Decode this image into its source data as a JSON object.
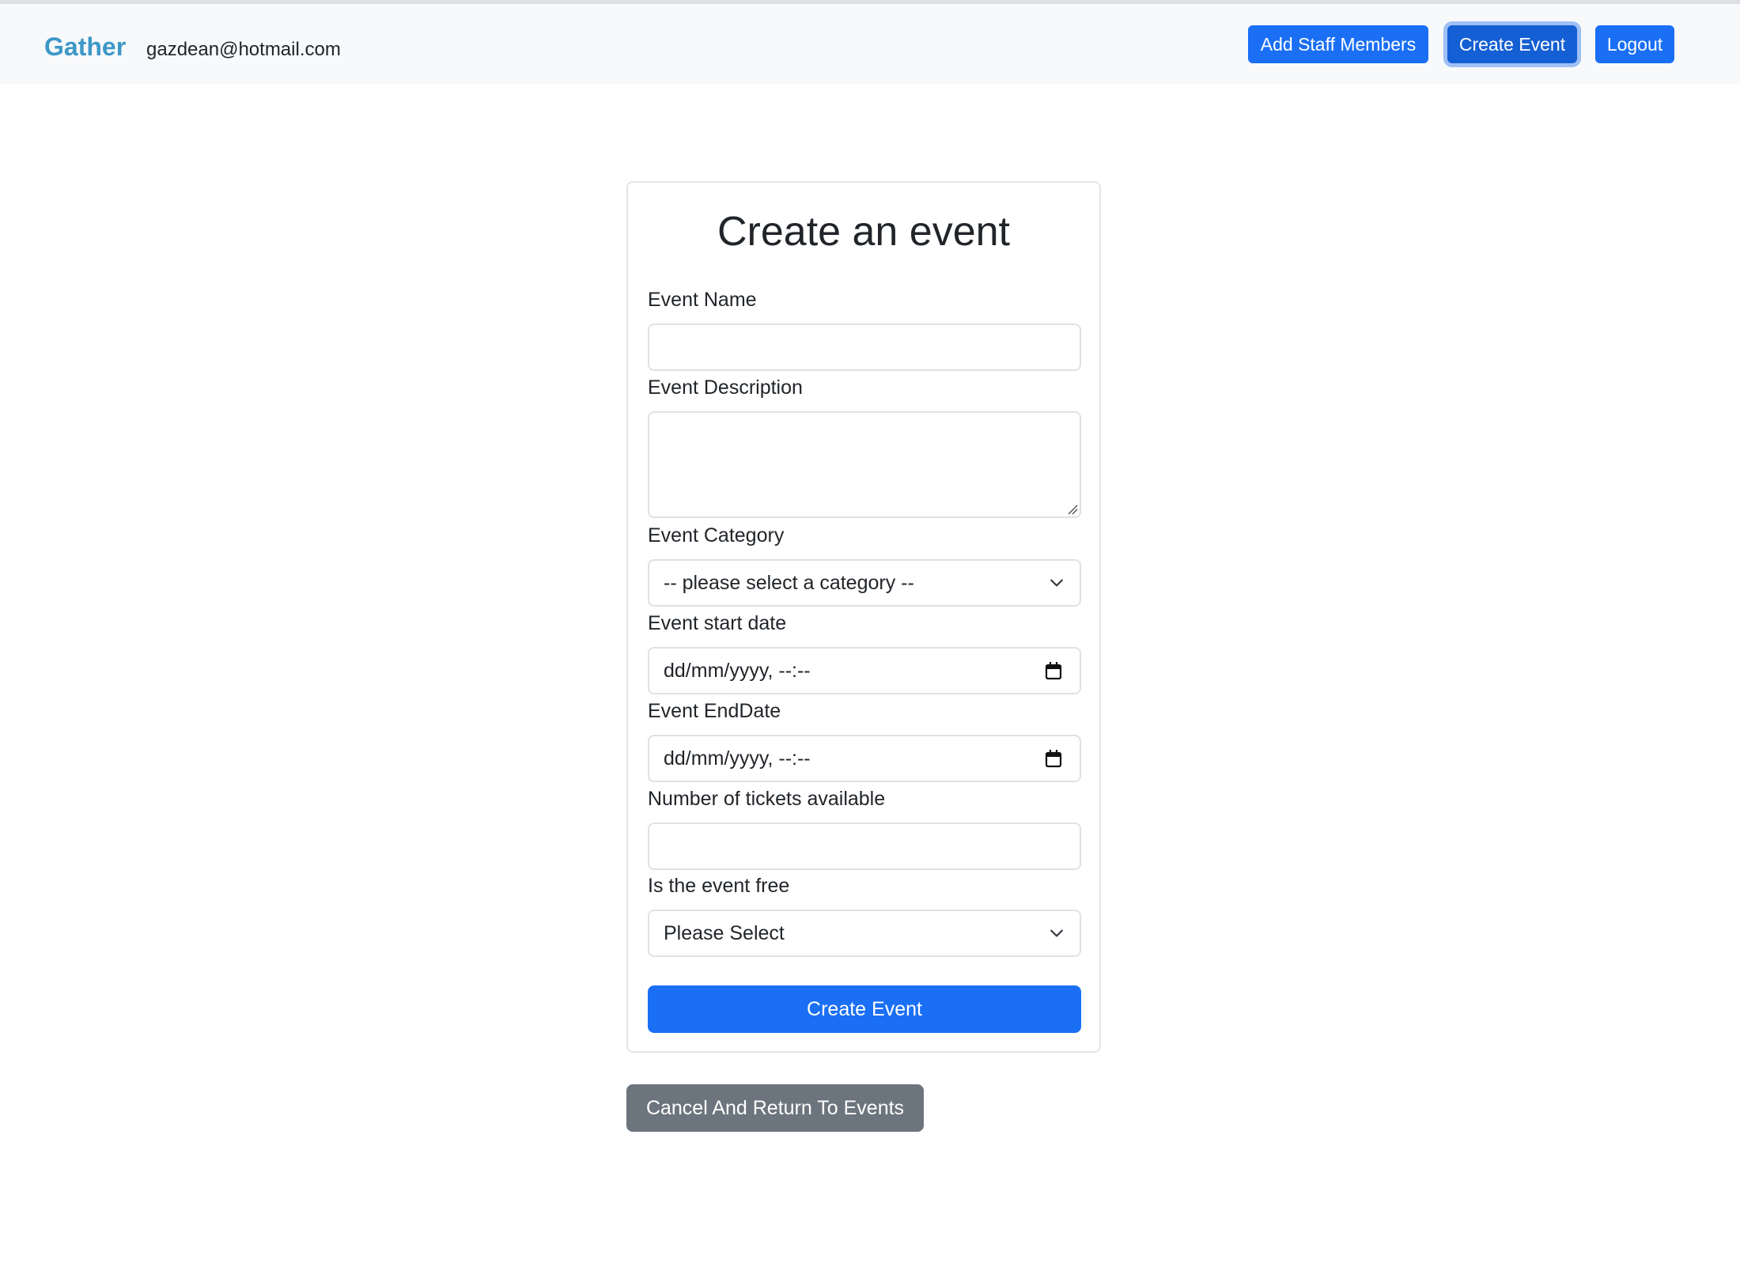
{
  "navbar": {
    "brand": "Gather",
    "user_email": "gazdean@hotmail.com",
    "buttons": {
      "add_staff": "Add Staff Members",
      "create_event": "Create Event",
      "logout": "Logout"
    }
  },
  "form": {
    "title": "Create an event",
    "event_name": {
      "label": "Event Name",
      "value": ""
    },
    "event_description": {
      "label": "Event Description",
      "value": ""
    },
    "event_category": {
      "label": "Event Category",
      "selected": "-- please select a category --"
    },
    "start_date": {
      "label": "Event start date",
      "value": "dd/mm/yyyy, --:--"
    },
    "end_date": {
      "label": "Event EndDate",
      "value": "dd/mm/yyyy, --:--"
    },
    "tickets": {
      "label": "Number of tickets available",
      "value": ""
    },
    "is_free": {
      "label": "Is the event free",
      "selected": "Please Select"
    },
    "submit_label": "Create Event"
  },
  "cancel_label": "Cancel And Return To Events",
  "icons": {
    "chevron": "chevron-down-icon",
    "calendar": "calendar-icon",
    "resize": "resize-grip-icon"
  },
  "colors": {
    "brand": "#3d98c8",
    "primary": "#1a6ff5",
    "primary_active": "#155fd4",
    "secondary": "#6c757d",
    "navbar_bg": "#f8f9fa"
  }
}
